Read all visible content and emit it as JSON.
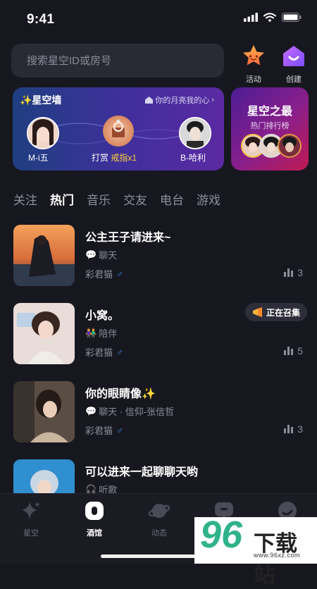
{
  "status_bar": {
    "time": "9:41"
  },
  "search": {
    "placeholder": "搜索星空ID或房号"
  },
  "top_buttons": {
    "activity_label": "活动",
    "create_label": "创建"
  },
  "star_wall": {
    "title": "✨星空墙",
    "link_text": "你的月亮我的心",
    "sender_name": "M-i五",
    "gift_text": "打赏",
    "gift_amount": "戒指x1",
    "receiver_name": "B-哈利"
  },
  "best_card": {
    "title": "星空之最",
    "subtitle": "热门排行榜"
  },
  "tabs": [
    {
      "label": "关注",
      "active": false
    },
    {
      "label": "热门",
      "active": true
    },
    {
      "label": "音乐",
      "active": false
    },
    {
      "label": "交友",
      "active": false
    },
    {
      "label": "电台",
      "active": false
    },
    {
      "label": "游戏",
      "active": false
    }
  ],
  "rooms": [
    {
      "title": "公主王子请进来~",
      "tag_icon": "💬",
      "tag": "聊天",
      "host": "彩君猫",
      "gender": "♂",
      "count": "3",
      "badge": ""
    },
    {
      "title": "小窝。",
      "tag_icon": "👫",
      "tag": "陪伴",
      "host": "彩君猫",
      "gender": "♂",
      "count": "5",
      "badge": "正在召集"
    },
    {
      "title": "你的眼睛像✨",
      "tag_icon": "💬",
      "tag": "聊天 · 信仰-张信哲",
      "host": "彩君猫",
      "gender": "♂",
      "count": "3",
      "badge": ""
    },
    {
      "title": "可以进来一起聊聊天哟",
      "tag_icon": "🎧",
      "tag": "听歌",
      "host": "",
      "gender": "",
      "count": "",
      "badge": ""
    }
  ],
  "bottom_nav": [
    {
      "label": "星空",
      "icon": "sparkle-icon",
      "active": false
    },
    {
      "label": "酒馆",
      "icon": "tavern-icon",
      "active": true
    },
    {
      "label": "动态",
      "icon": "planet-icon",
      "active": false
    },
    {
      "label": "",
      "icon": "message-icon",
      "active": false
    },
    {
      "label": "",
      "icon": "profile-icon",
      "active": false
    }
  ],
  "watermark": {
    "number": "96",
    "text": "下载站",
    "url": "www.96xz.com"
  },
  "colors": {
    "background": "#17171f",
    "accent_gold": "#ffcf3a",
    "male_blue": "#3e8ef7",
    "wall_gradient_start": "#1f3f80",
    "best_gradient_end": "#c01a52"
  }
}
